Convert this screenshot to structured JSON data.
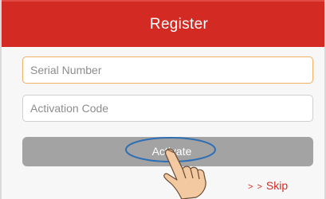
{
  "header": {
    "title": "Register"
  },
  "form": {
    "serial_placeholder": "Serial Number",
    "serial_value": "",
    "code_placeholder": "Activation Code",
    "code_value": "",
    "activate_label": "Activate"
  },
  "skip": {
    "arrows": "> >",
    "label": "Skip"
  },
  "annotations": {
    "highlight_icon": "ellipse-highlight-icon",
    "pointer_icon": "pointing-hand-icon"
  },
  "colors": {
    "header_red": "#d32a24",
    "button_gray": "#a3a3a3",
    "highlight_blue": "#2f6fb3",
    "skip_red": "#d32a24",
    "focus_orange": "#f0b56a"
  }
}
